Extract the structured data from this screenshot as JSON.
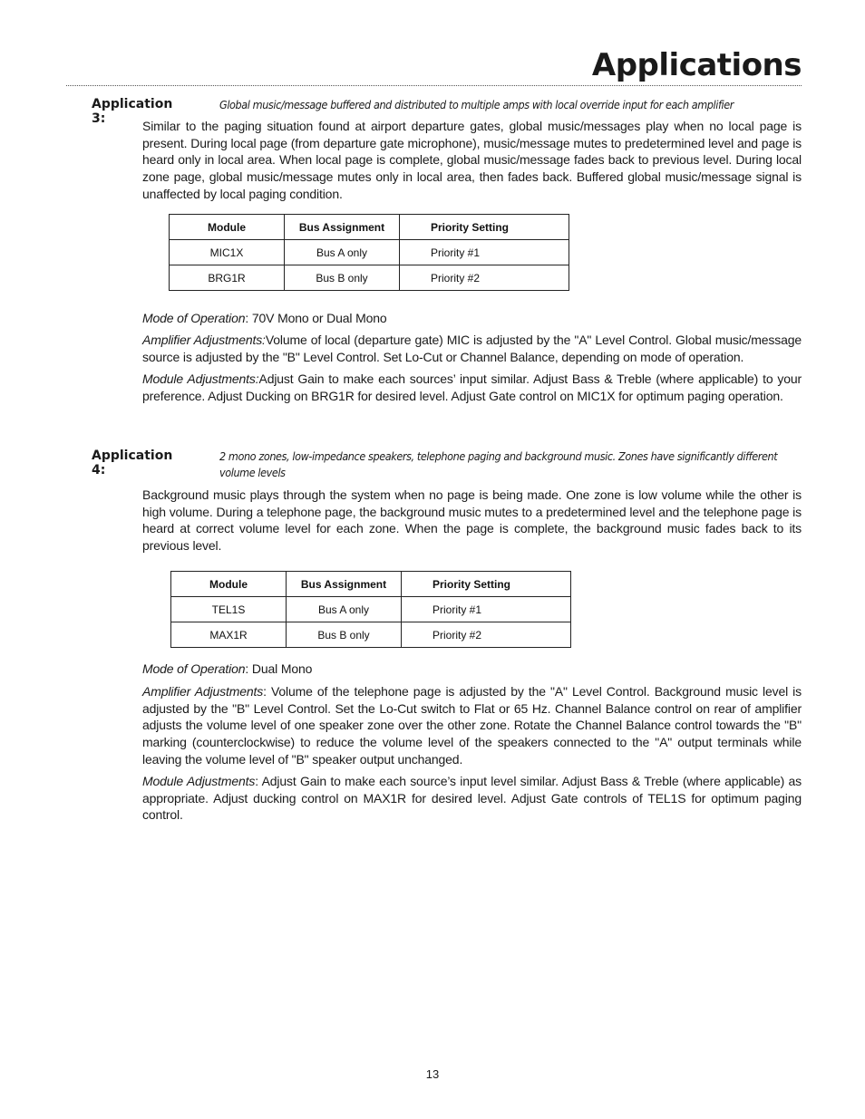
{
  "page": {
    "title": "Applications",
    "page_number": "13"
  },
  "applications": [
    {
      "label": "Application 3:",
      "subtitle": "Global music/message buffered and distributed to multiple amps with local override input for each amplifier",
      "description": "Similar to the paging situation found at airport departure gates, global music/messages play when no local page is present. During local page (from departure gate microphone), music/message mutes to predetermined level and page is heard only in local area.  When local page is complete, global music/message fades back to previous level. During local zone page, global music/message mutes only in local area, then fades back. Buffered global music/message signal is unaffected by local paging condition.",
      "table": {
        "headers": [
          "Module",
          "Bus Assignment",
          "Priority Setting"
        ],
        "rows": [
          [
            "MIC1X",
            "Bus A only",
            "Priority #1"
          ],
          [
            "BRG1R",
            "Bus B only",
            "Priority #2"
          ]
        ]
      },
      "mode_label": "Mode of Operation",
      "mode_value": ": 70V Mono or Dual Mono",
      "amp_label": "Amplifier Adjustments:",
      "amp_text": "Volume of local (departure gate) MIC is adjusted by the \"A\" Level Control. Global music/message source is adjusted by the \"B\" Level Control. Set Lo-Cut or Channel Balance, depending on mode of operation.",
      "module_label": "Module Adjustments:",
      "module_text": "Adjust Gain to make each sources’ input similar.  Adjust Bass & Treble (where applicable) to your preference. Adjust Ducking on BRG1R for desired level.  Adjust Gate control on MIC1X for optimum paging operation."
    },
    {
      "label": "Application 4:",
      "subtitle": "2 mono zones, low-impedance speakers, telephone paging and background music. Zones have significantly different volume levels",
      "description": "Background music plays through the system when no page is being made. One zone is low volume while the other is high volume. During a telephone page, the background music mutes to a predetermined level and the telephone page is heard at correct volume level for each zone. When the page is complete, the background music fades back to its previous level.",
      "table": {
        "headers": [
          "Module",
          "Bus Assignment",
          "Priority Setting"
        ],
        "rows": [
          [
            "TEL1S",
            "Bus A only",
            "Priority #1"
          ],
          [
            "MAX1R",
            "Bus B only",
            "Priority #2"
          ]
        ]
      },
      "mode_label": "Mode of Operation",
      "mode_value": ": Dual Mono",
      "amp_label": "Amplifier Adjustments",
      "amp_text": ":  Volume of the telephone page is adjusted by the \"A\" Level Control. Background music level is adjusted by the \"B\" Level Control. Set the Lo-Cut switch to Flat or 65 Hz. Channel Balance control on rear of amplifier adjusts the volume level of one speaker zone over the other zone. Rotate the Channel Balance control towards the \"B\" marking (counterclockwise) to reduce the volume level of the speakers connected to the \"A\" output terminals while leaving the volume level of \"B\" speaker output unchanged.",
      "module_label": "Module Adjustments",
      "module_text": ":  Adjust Gain to make each source’s input level similar. Adjust Bass & Treble (where applicable) as appropriate. Adjust ducking control on MAX1R for desired level.  Adjust Gate controls of TEL1S for optimum paging control."
    }
  ]
}
